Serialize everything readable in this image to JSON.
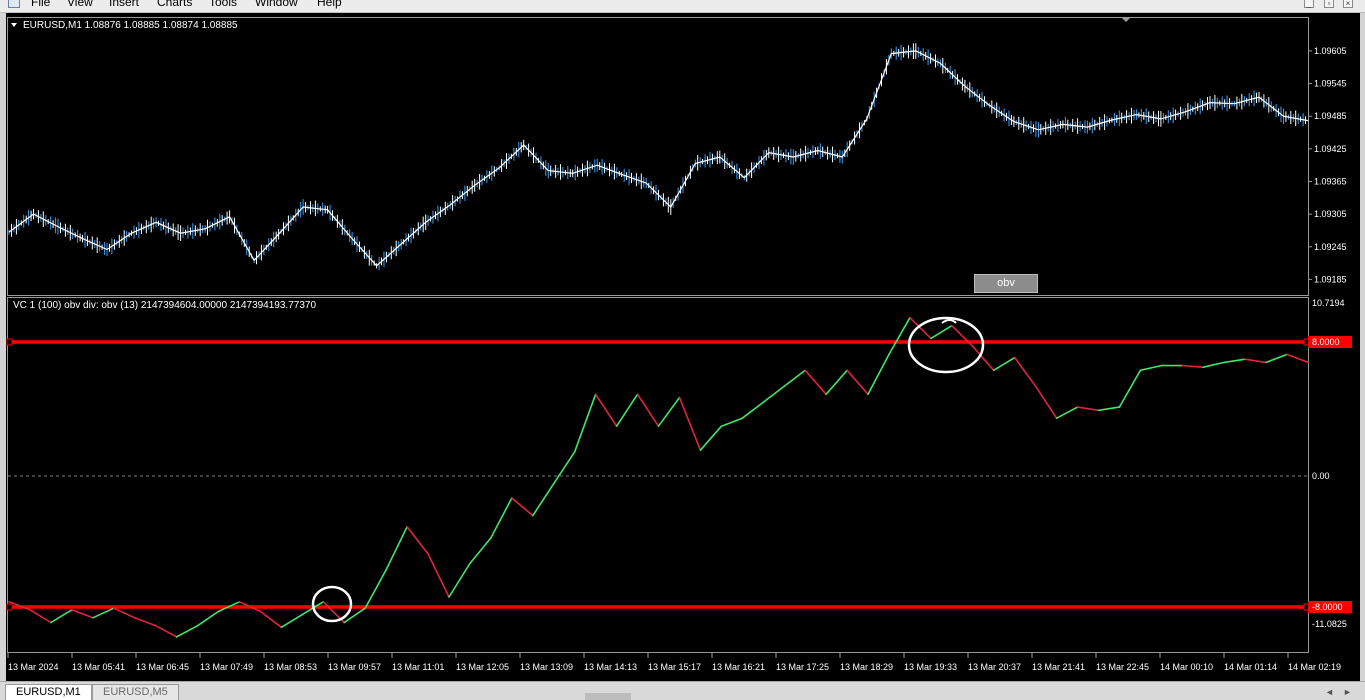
{
  "menu": {
    "items": [
      {
        "key": "file",
        "label": "File"
      },
      {
        "key": "view",
        "label": "View"
      },
      {
        "key": "insert",
        "label": "Insert"
      },
      {
        "key": "charts",
        "label": "Charts"
      },
      {
        "key": "tools",
        "label": "Tools"
      },
      {
        "key": "window",
        "label": "Window"
      },
      {
        "key": "help",
        "label": "Help"
      }
    ]
  },
  "main_chart": {
    "header": "EURUSD,M1  1.08876 1.08885 1.08874 1.08885",
    "price_ticks": [
      "1.09605",
      "1.09545",
      "1.09485",
      "1.09425",
      "1.09365",
      "1.09305",
      "1.09245",
      "1.09185"
    ],
    "obv_button": "obv",
    "colors": {
      "bar": "#ffffff",
      "bull": "#3aa0ff",
      "bear": "#7cfc84",
      "background": "#000000"
    }
  },
  "indicator": {
    "header": "VC 1 (100)  obv div: obv (13) 2147394604.00000 2147394193.77370",
    "scale_max": "10.7194",
    "scale_zero": "0.00",
    "scale_min": "-11.0825",
    "upper_level": "8.0000",
    "lower_level": "-8.0000",
    "colors": {
      "up": "#3ee66a",
      "down": "#e0243c",
      "level": "#ff0000"
    }
  },
  "time_axis": [
    "13 Mar 2024",
    "13 Mar 05:41",
    "13 Mar 06:45",
    "13 Mar 07:49",
    "13 Mar 08:53",
    "13 Mar 09:57",
    "13 Mar 11:01",
    "13 Mar 12:05",
    "13 Mar 13:09",
    "13 Mar 14:13",
    "13 Mar 15:17",
    "13 Mar 16:21",
    "13 Mar 17:25",
    "13 Mar 18:29",
    "13 Mar 19:33",
    "13 Mar 20:37",
    "13 Mar 21:41",
    "13 Mar 22:45",
    "14 Mar 00:10",
    "14 Mar 01:14",
    "14 Mar 02:19"
  ],
  "tabs": [
    {
      "label": "EURUSD,M1",
      "active": true
    },
    {
      "label": "EURUSD,M5",
      "active": false
    }
  ],
  "chart_data": [
    {
      "type": "line",
      "title": "EURUSD,M1",
      "ylim": [
        1.0916,
        1.0966
      ],
      "series": [
        {
          "name": "EURUSD,M1",
          "values": [
            1.09272,
            1.09305,
            1.09282,
            1.0926,
            1.0924,
            1.0927,
            1.0929,
            1.0927,
            1.09278,
            1.093,
            1.0922,
            1.09268,
            1.09318,
            1.09313,
            1.0926,
            1.0921,
            1.0925,
            1.0929,
            1.09322,
            1.09358,
            1.0939,
            1.09432,
            1.09385,
            1.0938,
            1.09395,
            1.09378,
            1.09362,
            1.09318,
            1.09398,
            1.0941,
            1.09372,
            1.09418,
            1.0941,
            1.09422,
            1.0941,
            1.0948,
            1.096,
            1.09605,
            1.09582,
            1.0954,
            1.09505,
            1.09475,
            1.0946,
            1.0947,
            1.09465,
            1.09478,
            1.09488,
            1.0948,
            1.09493,
            1.0951,
            1.09508,
            1.0952,
            1.09485,
            1.09477
          ]
        }
      ]
    },
    {
      "type": "line",
      "title": "VC 1 (100)  obv div: obv (13)",
      "ylim": [
        -11.0825,
        10.7194
      ],
      "levels": [
        8.0,
        -8.0,
        0.0
      ],
      "series": [
        {
          "name": "obv",
          "values": [
            -8.0,
            -8.5,
            -9.3,
            -8.5,
            -9.0,
            -8.4,
            -9.0,
            -9.5,
            -10.2,
            -9.5,
            -8.6,
            -8.0,
            -8.6,
            -9.6,
            -8.8,
            -8.0,
            -9.3,
            -8.4,
            -6.0,
            -3.3,
            -5.0,
            -7.7,
            -5.6,
            -4.0,
            -1.5,
            -2.6,
            -0.6,
            1.4,
            5.0,
            3.0,
            5.0,
            3.0,
            4.8,
            1.5,
            3.0,
            3.5,
            4.5,
            5.5,
            6.5,
            5.0,
            6.5,
            5.0,
            7.5,
            9.8,
            8.5,
            9.3,
            8.0,
            6.5,
            7.3,
            5.5,
            3.5,
            4.2,
            4.0,
            4.2,
            6.5,
            6.8,
            6.8,
            6.7,
            7.0,
            7.2,
            7.0,
            7.5,
            7.0
          ]
        },
        {
          "name": "direction",
          "values": [
            1,
            0,
            0,
            1,
            0,
            1,
            0,
            0,
            0,
            1,
            1,
            1,
            0,
            0,
            1,
            1,
            0,
            1,
            1,
            1,
            0,
            0,
            1,
            1,
            1,
            0,
            1,
            1,
            1,
            0,
            1,
            0,
            1,
            0,
            1,
            1,
            1,
            1,
            1,
            0,
            1,
            0,
            1,
            1,
            0,
            1,
            0,
            0,
            1,
            0,
            0,
            1,
            0,
            1,
            1,
            1,
            1,
            0,
            1,
            1,
            0,
            1,
            0
          ]
        }
      ]
    }
  ]
}
